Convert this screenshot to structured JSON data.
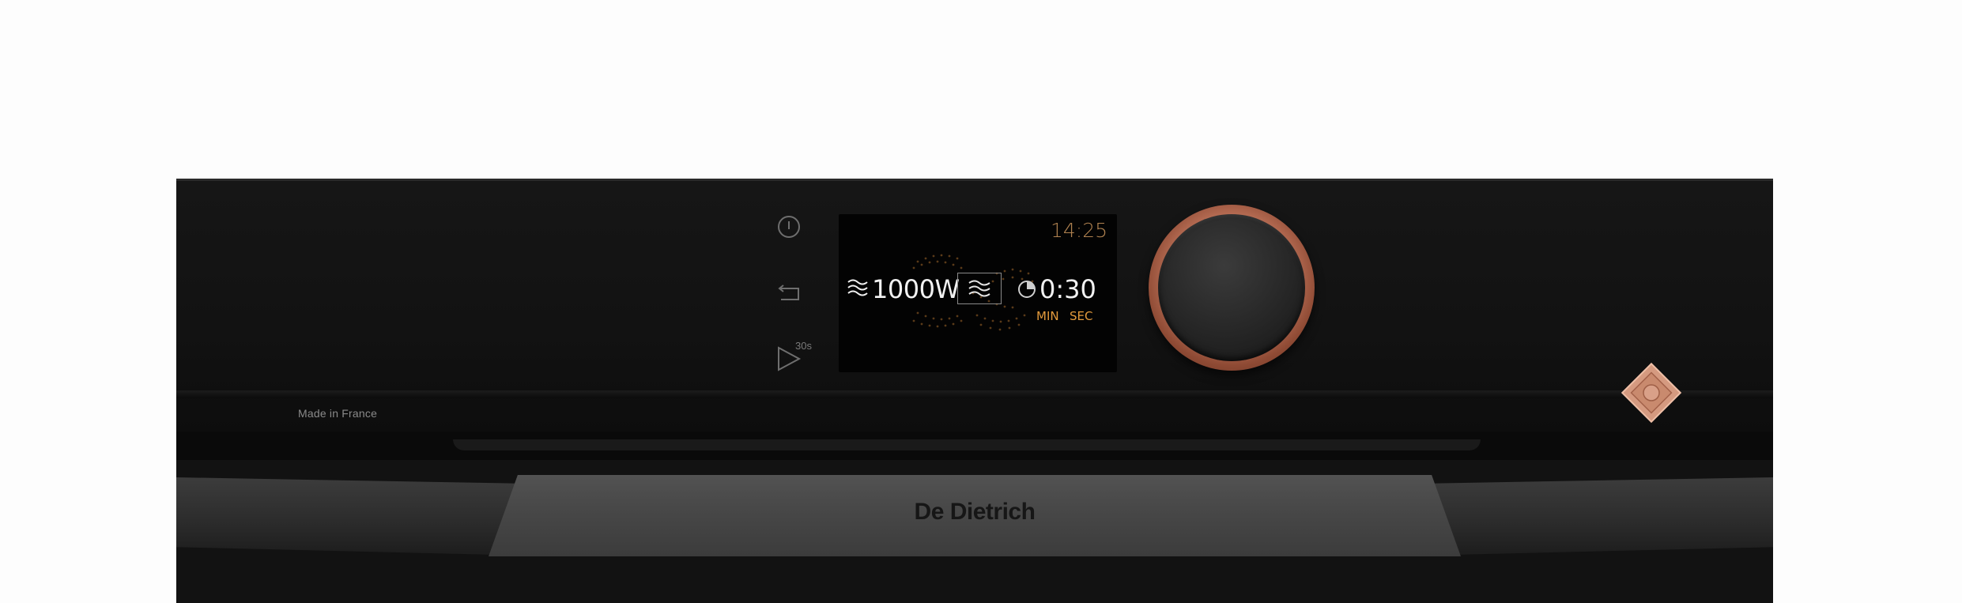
{
  "panel": {
    "made_in": "Made in France",
    "buttons": [
      {
        "name": "power-button",
        "icon": "power-icon"
      },
      {
        "name": "back-button",
        "icon": "return-arrow-icon"
      },
      {
        "name": "quick-start-button",
        "icon": "play-icon",
        "badge": "30s"
      }
    ]
  },
  "display": {
    "clock": "14:25",
    "power": "1000W",
    "mode_icon": "microwave-waves-icon",
    "timer": "0:30",
    "timer_units": [
      "MIN",
      "SEC"
    ]
  },
  "door": {
    "brand": "De Dietrich"
  },
  "colors": {
    "accent_copper": "#c67a60",
    "display_orange": "#e39a3c",
    "clock_gold": "#b08250"
  }
}
